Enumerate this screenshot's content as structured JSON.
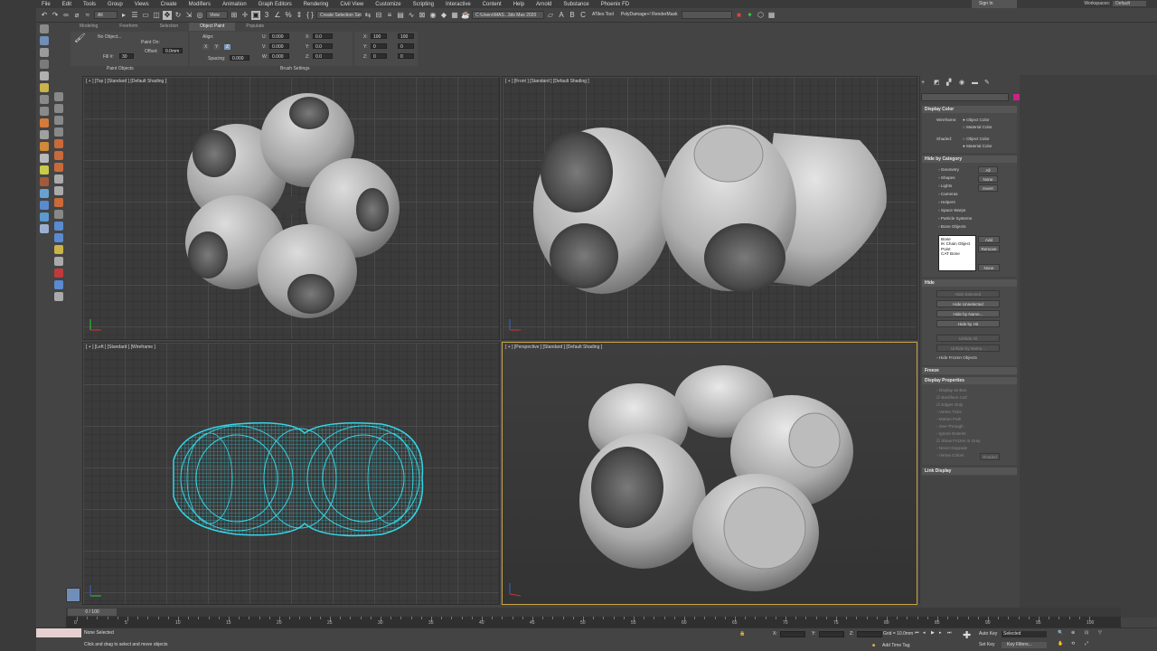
{
  "menu": [
    "File",
    "Edit",
    "Tools",
    "Group",
    "Views",
    "Create",
    "Modifiers",
    "Animation",
    "Graph Editors",
    "Rendering",
    "Civil View",
    "Customize",
    "Scripting",
    "Interactive",
    "Content",
    "Help",
    "Arnold",
    "Substance",
    "Phoenix FD"
  ],
  "account": {
    "sign_in": "Sign In",
    "workspaces_label": "Workspaces:",
    "workspace": "Default"
  },
  "toolbar": {
    "selection_filter": "All",
    "ref_coord": "View",
    "named_selection": "Create Selection Set",
    "project_path": "C:\\Users\\MAS...3ds Max 2020",
    "atiles": "ATiles Tool",
    "polydamage": "PolyDamage+! RenderMask"
  },
  "ribbon": {
    "tabs": [
      "Modeling",
      "Freeform",
      "Selection",
      "Object Paint",
      "Populate"
    ],
    "active_tab": "Object Paint",
    "paint_objects": {
      "object": "No Object...",
      "paint_on": "Paint On:",
      "fill": "Fill #:",
      "fill_val": "30",
      "offset": "Offset:",
      "offset_val": "0.0mm",
      "label": "Paint Objects"
    },
    "align": {
      "label": "Align:",
      "x": "X",
      "y": "Y",
      "z": "Z",
      "spacing": "Spacing:",
      "spacing_val": "0.000"
    },
    "brush": {
      "u": "U:",
      "v": "V:",
      "w": "W:",
      "uval": "0.000",
      "vval": "0.000",
      "wval": "0.000",
      "x": "X:",
      "y": "Y:",
      "z": "Z:",
      "xval": "0.0",
      "yval": "0.0",
      "zval": "0.0",
      "xs": "X:",
      "ys": "Y:",
      "zs": "Z:",
      "xsval": "100",
      "ysval": "0",
      "zsval": "0",
      "n1": "100",
      "n2": "0",
      "n3": "0",
      "label": "Brush Settings"
    }
  },
  "viewports": {
    "top": "[ + ] [Top ] [Standard ] [Default Shading ]",
    "front": "[ + ] [Front ] [Standard ] [Default Shading ]",
    "left": "[ + ] [Left ] [Standard ] [Wireframe ]",
    "perspective": "[ + ] [Perspective ] [Standard ] [Default Shading ]"
  },
  "command_panel": {
    "display_color": {
      "header": "Display Color",
      "wireframe": "Wireframe:",
      "shaded": "Shaded:",
      "object_color": "Object Color",
      "material_color": "Material Color"
    },
    "hide_by_category": {
      "header": "Hide by Category",
      "items": [
        "Geometry",
        "Shapes",
        "Lights",
        "Cameras",
        "Helpers",
        "Space Warps",
        "Particle Systems",
        "Bone Objects"
      ],
      "buttons": {
        "all": "All",
        "none": "None",
        "invert": "Invert",
        "add": "Add",
        "remove": "Remove",
        "none2": "None"
      },
      "list": [
        "Bone",
        "IK Chain Object",
        "Point",
        "CAT Bone"
      ]
    },
    "hide": {
      "header": "Hide",
      "buttons": [
        "Hide Selected",
        "Hide Unselected",
        "Hide by Name...",
        "Hide by Hit",
        "Unhide All",
        "Unhide by Name..."
      ],
      "frozen": "Hide Frozen Objects"
    },
    "freeze": {
      "header": "Freeze"
    },
    "display_properties": {
      "header": "Display Properties",
      "items": [
        "Display as Box",
        "Backface Cull",
        "Edges Only",
        "Vertex Ticks",
        "Motion Path",
        "See-Through",
        "Ignore Extents",
        "Show Frozen in Gray",
        "Never Degrade",
        "Vertex Colors"
      ],
      "shaded_btn": "Shaded"
    },
    "link_display": {
      "header": "Link Display"
    }
  },
  "timeline": {
    "frame_display": "0 / 100",
    "ticks": [
      "0",
      "5",
      "10",
      "15",
      "20",
      "25",
      "30",
      "35",
      "40",
      "45",
      "50",
      "55",
      "60",
      "65",
      "70",
      "75",
      "80",
      "85",
      "90",
      "95",
      "100"
    ]
  },
  "status": {
    "selection": "None Selected",
    "prompt": "Click and drag to select and move objects",
    "x_label": "X:",
    "y_label": "Y:",
    "z_label": "Z:",
    "grid": "Grid = 10.0mm",
    "add_time_tag": "Add Time Tag",
    "auto_key": "Auto Key",
    "set_key": "Set Key",
    "selected": "Selected",
    "key_filters": "Key Filters..."
  },
  "colors": {
    "wireframe": "#33d6e6",
    "accent_active_vp": "#c9a54a",
    "swatch": "#cc2288"
  }
}
